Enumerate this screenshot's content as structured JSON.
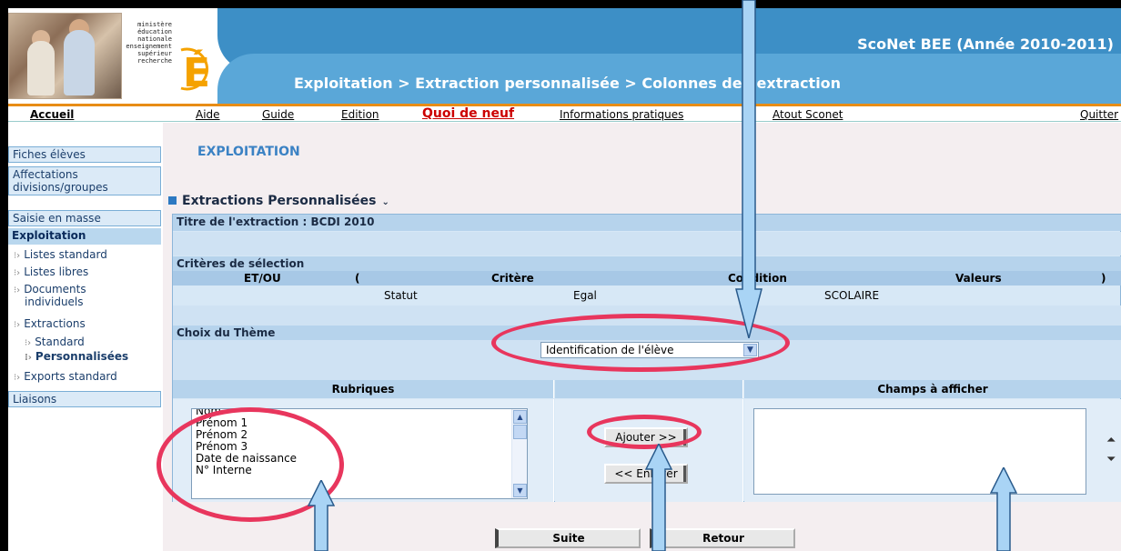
{
  "header": {
    "ministere_lines": [
      "ministère",
      "éducation",
      "nationale",
      "enseignement",
      "supérieur",
      "recherche"
    ],
    "logo_letter": "É",
    "app_title": "ScoNet BEE (Année 2010-2011)",
    "breadcrumb": "Exploitation > Extraction personnalisée > Colonnes de l'extraction"
  },
  "nav": {
    "accueil": "Accueil",
    "aide": "Aide",
    "guide": "Guide",
    "edition": "Edition",
    "quoi_de_neuf": "Quoi de neuf",
    "infos": "Informations pratiques",
    "atout": "Atout Sconet",
    "quitter": "Quitter"
  },
  "sidebar": {
    "fiches": "Fiches élèves",
    "affectations_1": "Affectations",
    "affectations_2": "divisions/groupes",
    "saisie": "Saisie en masse",
    "exploitation": "Exploitation",
    "listes_standard": "Listes standard",
    "listes_libres": "Listes libres",
    "documents_1": "Documents",
    "documents_2": "individuels",
    "extractions": "Extractions",
    "standard": "Standard",
    "personnalisees": "Personnalisées",
    "exports": "Exports standard",
    "liaisons": "Liaisons"
  },
  "main": {
    "heading": "EXPLOITATION",
    "section": "Extractions Personnalisées",
    "titre_extraction": "Titre de l'extraction : BCDI 2010",
    "criteres_label": "Critères de sélection",
    "criteria_headers": {
      "etou": "ET/OU",
      "open": "(",
      "critere": "Critère",
      "condition": "Condition",
      "valeurs": "Valeurs",
      "close": ")"
    },
    "criteria_row": {
      "critere": "Statut",
      "condition": "Egal",
      "valeurs": "SCOLAIRE"
    },
    "theme_label": "Choix du Thème",
    "theme_value": "Identification de l'élève",
    "rubriques_header": "Rubriques",
    "champs_header": "Champs à afficher",
    "rubriques": [
      "Nom",
      "Prénom 1",
      "Prénom 2",
      "Prénom 3",
      "Date de naissance",
      "N° Interne"
    ],
    "ajouter": "Ajouter >>",
    "enlever": "<< Enlever",
    "suite": "Suite",
    "retour": "Retour"
  }
}
